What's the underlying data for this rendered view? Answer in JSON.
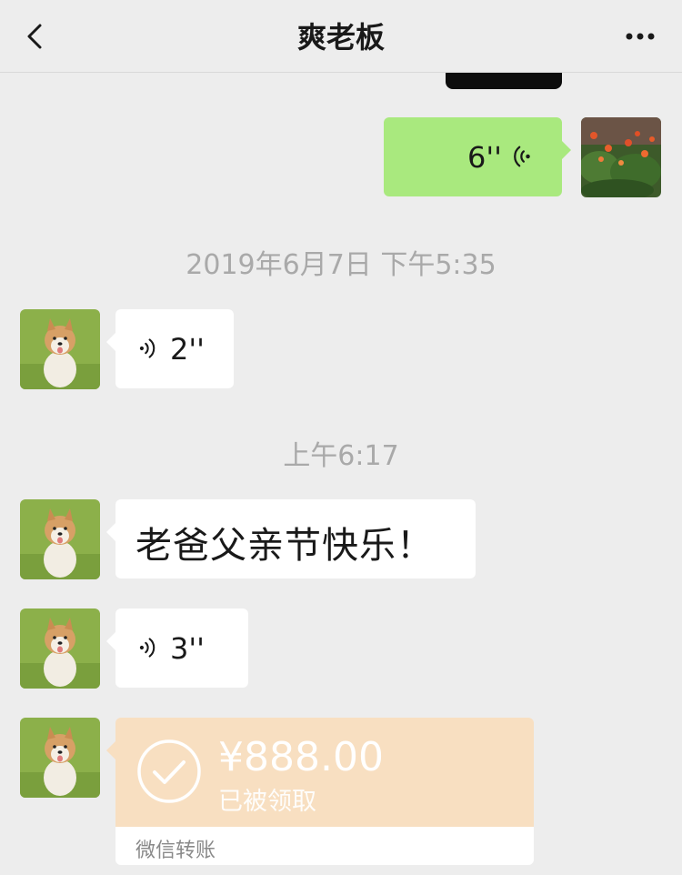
{
  "header": {
    "title": "爽老板",
    "back_icon": "chevron-left-icon",
    "more_icon": "more-horizontal-icon"
  },
  "messages": {
    "sent_voice": {
      "duration": "6''",
      "icon": "voice-wave-icon"
    },
    "timestamp_1": "2019年6月7日 下午5:35",
    "recv_voice_1": {
      "duration": "2''",
      "icon": "voice-wave-icon"
    },
    "timestamp_2": "上午6:17",
    "recv_text": "老爸父亲节快乐！",
    "recv_voice_2": {
      "duration": "3''",
      "icon": "voice-wave-icon"
    },
    "transfer": {
      "amount": "¥888.00",
      "status": "已被领取",
      "label": "微信转账",
      "icon": "check-circle-icon"
    }
  },
  "colors": {
    "background": "#ededed",
    "sent_bubble": "#a9e97e",
    "recv_bubble": "#ffffff",
    "transfer": "#f8dfc1",
    "timestamp": "#a9a9a9"
  }
}
